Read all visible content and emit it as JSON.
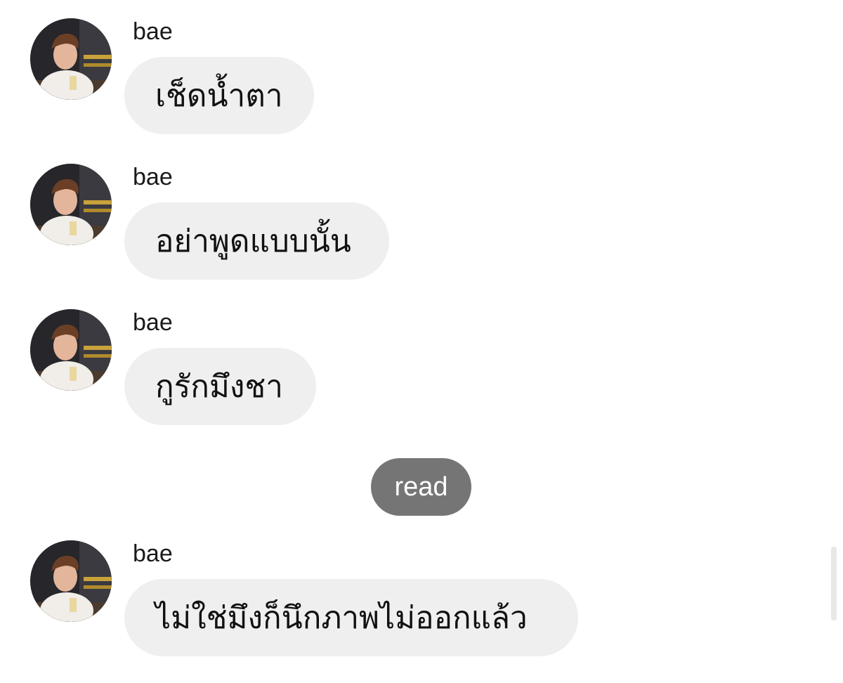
{
  "conversation": {
    "messages": [
      {
        "sender": "bae",
        "text": "เช็ดน้ำตา",
        "avatar_icon": "profile-photo-icon"
      },
      {
        "sender": "bae",
        "text": "อย่าพูดแบบนั้น",
        "avatar_icon": "profile-photo-icon"
      },
      {
        "sender": "bae",
        "text": "กูรักมึงชา",
        "avatar_icon": "profile-photo-icon"
      },
      {
        "sender": "bae",
        "text": "ไม่ใช่มึงก็นึกภาพไม่ออกแล้ว",
        "avatar_icon": "profile-photo-icon"
      }
    ],
    "read_receipt": "read"
  },
  "colors": {
    "bubble": "#efefef",
    "read_pill": "#757575",
    "background": "#ffffff"
  }
}
